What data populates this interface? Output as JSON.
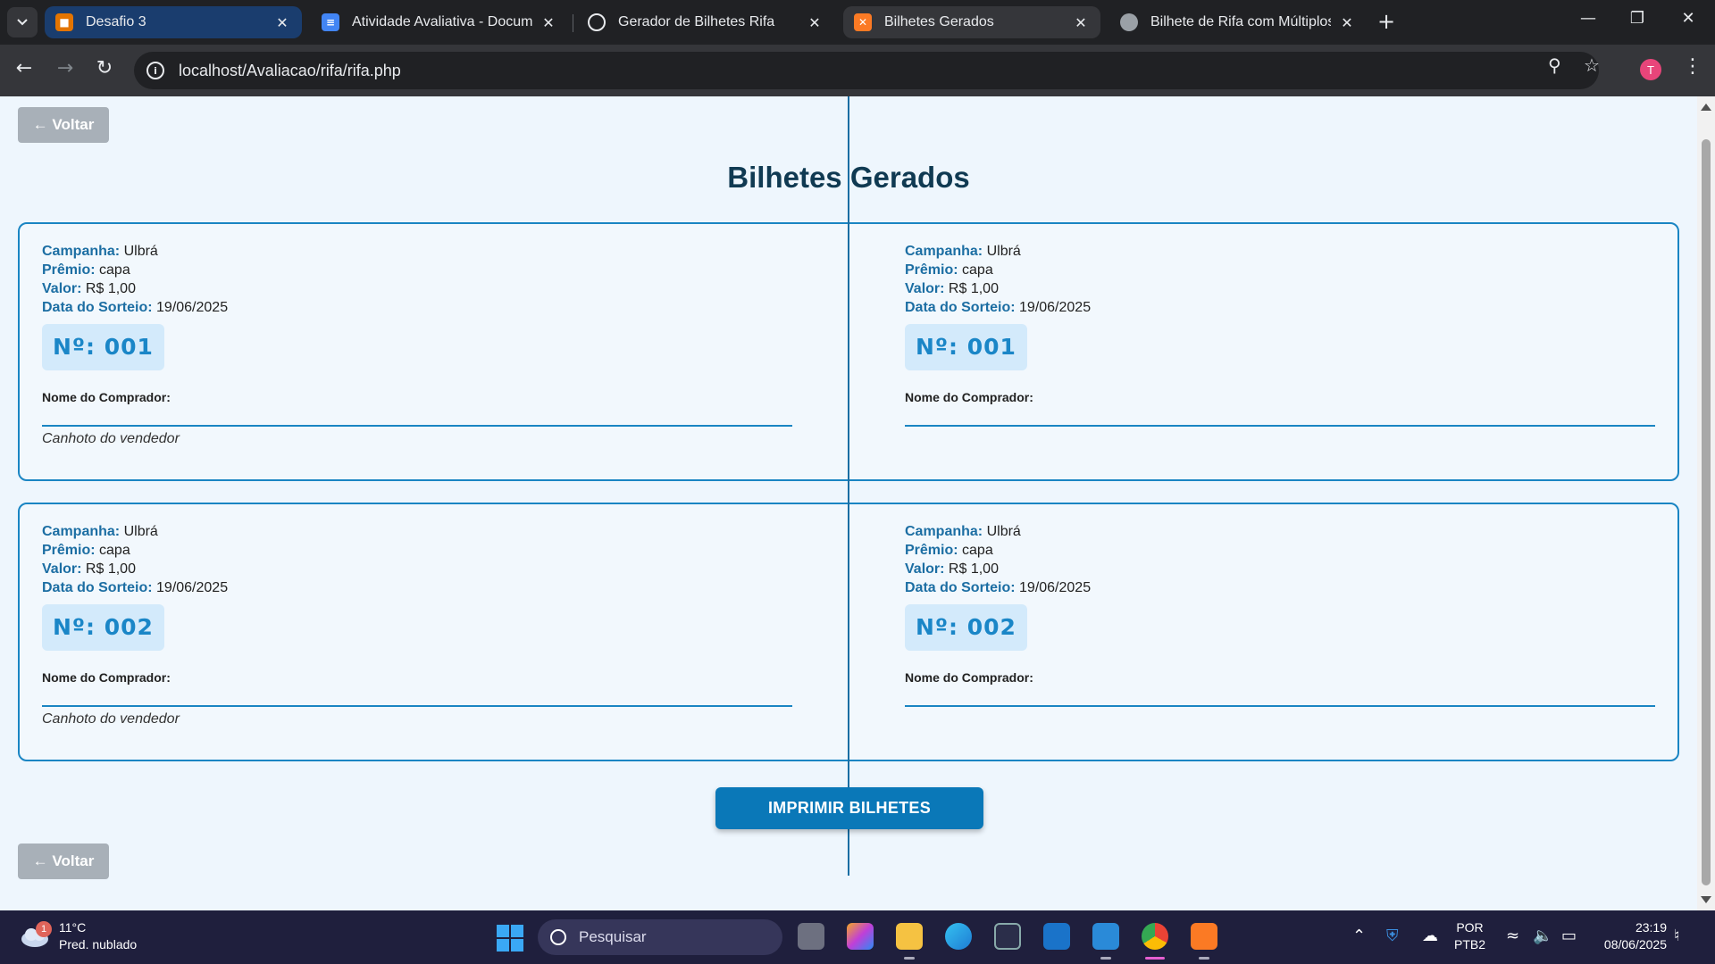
{
  "browser": {
    "tabs": [
      {
        "title": "Desafio 3",
        "icon": "classroom-icon",
        "color": "#e37400"
      },
      {
        "title": "Atividade Avaliativa - Documen",
        "icon": "docs-icon",
        "color": "#4285f4"
      },
      {
        "title": "Gerador de Bilhetes Rifa",
        "icon": "chatgpt-icon",
        "color": "#ffffff"
      },
      {
        "title": "Bilhetes Gerados",
        "icon": "xampp-icon",
        "color": "#fb7a24"
      },
      {
        "title": "Bilhete de Rifa com Múltiplos P",
        "icon": "globe-icon",
        "color": "#9aa0a6"
      }
    ],
    "url": "localhost/Avaliacao/rifa/rifa.php",
    "profile_initial": "T"
  },
  "page": {
    "back_label": "← Voltar",
    "title": "Bilhetes Gerados",
    "labels": {
      "campaign": "Campanha:",
      "prize": "Prêmio:",
      "value": "Valor:",
      "draw_date": "Data do Sorteio:",
      "buyer": "Nome do Comprador:",
      "stub": "Canhoto do vendedor"
    },
    "tickets": [
      {
        "campaign": "Ulbrá",
        "prize": "capa",
        "value": "R$ 1,00",
        "draw_date": "19/06/2025",
        "number": "Nº: 001"
      },
      {
        "campaign": "Ulbrá",
        "prize": "capa",
        "value": "R$ 1,00",
        "draw_date": "19/06/2025",
        "number": "Nº: 002"
      }
    ],
    "print_label": "IMPRIMIR BILHETES"
  },
  "taskbar": {
    "weather_temp": "11°C",
    "weather_desc": "Pred. nublado",
    "weather_badge": "1",
    "search_placeholder": "Pesquisar",
    "lang_line1": "POR",
    "lang_line2": "PTB2",
    "time": "23:19",
    "date": "08/06/2025"
  }
}
